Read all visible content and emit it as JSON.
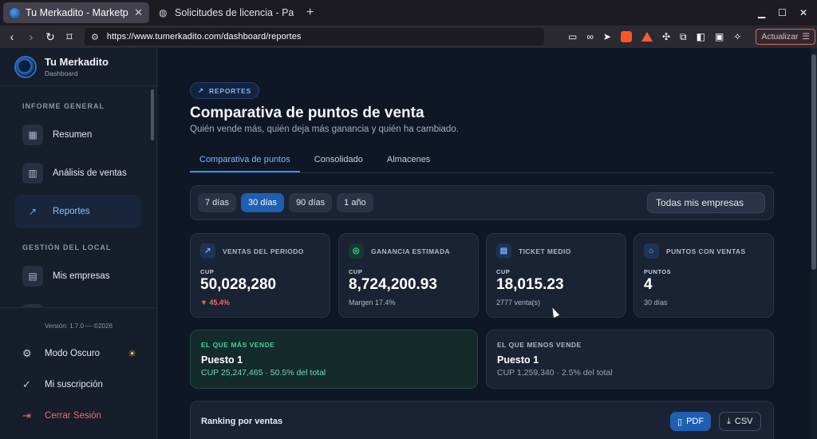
{
  "browser": {
    "tabs": [
      {
        "title": "Tu Merkadito - Marketpla",
        "active": true
      },
      {
        "title": "Solicitudes de licencia - Panel",
        "active": false
      }
    ],
    "new_tab": "+",
    "url": "https://www.tumerkadito.com/dashboard/reportes",
    "update_label": "Actualizar"
  },
  "sidebar": {
    "brand_name": "Tu Merkadito",
    "brand_sub": "Dashboard",
    "section_general": "INFORME GENERAL",
    "section_local": "GESTIÓN DEL LOCAL",
    "items": [
      {
        "label": "Resumen",
        "icon": "grid-icon"
      },
      {
        "label": "Análisis de ventas",
        "icon": "bar-chart-icon"
      },
      {
        "label": "Reportes",
        "icon": "trend-icon"
      },
      {
        "label": "Mis empresas",
        "icon": "building-icon"
      }
    ],
    "version": "Versión: 1.7.0 — ©2026",
    "footer": {
      "dark_mode": "Modo Oscuro",
      "subscription": "Mi suscripción",
      "logout": "Cerrar Sesión"
    }
  },
  "main": {
    "badge": "REPORTES",
    "title": "Comparativa de puntos de venta",
    "subtitle": "Quién vende más, quién deja más ganancia y quién ha cambiado.",
    "tabs": [
      "Comparativa de puntos",
      "Consolidado",
      "Almacenes"
    ],
    "periods": [
      "7 días",
      "30 días",
      "90 días",
      "1 año"
    ],
    "selected_period": "30 días",
    "company_select": "Todas mis empresas",
    "kpis": [
      {
        "label": "VENTAS DEL PERIODO",
        "currency": "CUP",
        "value": "50,028,280",
        "note": "▼ 45.4%"
      },
      {
        "label": "GANANCIA ESTIMADA",
        "currency": "CUP",
        "value": "8,724,200.93",
        "note": "Margen 17.4%"
      },
      {
        "label": "TICKET MEDIO",
        "currency": "CUP",
        "value": "18,015.23",
        "note": "2777 venta(s)"
      },
      {
        "label": "PUNTOS CON VENTAS",
        "currency": "PUNTOS",
        "value": "4",
        "note": "30 días"
      }
    ],
    "best": {
      "label": "EL QUE MÁS VENDE",
      "title": "Puesto 1",
      "detail": "CUP 25,247,465 · 50.5% del total"
    },
    "worst": {
      "label": "EL QUE MENOS VENDE",
      "title": "Puesto 1",
      "detail": "CUP 1,259,340 · 2.5% del total"
    },
    "ranking": {
      "title": "Ranking por ventas",
      "pdf": "PDF",
      "csv": "CSV"
    }
  },
  "colors": {
    "accent": "#1e5fb4",
    "positive": "#3fd69a",
    "negative": "#f06b6b"
  }
}
